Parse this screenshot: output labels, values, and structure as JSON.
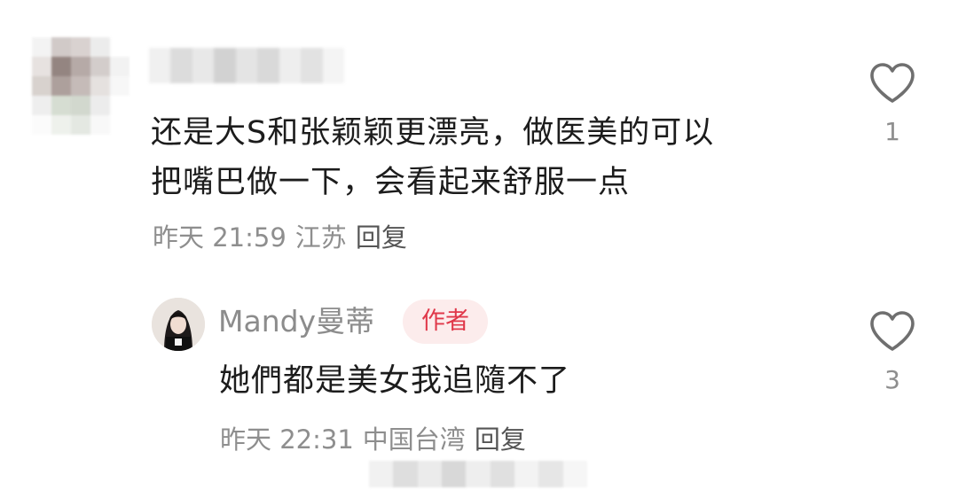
{
  "comment": {
    "text": "还是大S和张颖颖更漂亮，做医美的可以\n把嘴巴做一下，会看起来舒服一点",
    "line1": "还是大S和张颖颖更漂亮，做医美的可以",
    "line2": "把嘴巴做一下，会看起来舒服一点",
    "time": "昨天 21:59",
    "location": "江苏",
    "reply_label": "回复",
    "like_count": "1"
  },
  "reply": {
    "author_name": "Mandy曼蒂",
    "author_badge": "作者",
    "text": "她們都是美女我追隨不了",
    "time": "昨天 22:31",
    "location": "中国台湾",
    "reply_label": "回复",
    "like_count": "3"
  },
  "icons": {
    "like": "heart-outline-icon"
  },
  "colors": {
    "text_primary": "#1c1c1c",
    "text_meta": "#8e8e8e",
    "badge_text": "#e0384a",
    "badge_bg": "#fcecec"
  }
}
